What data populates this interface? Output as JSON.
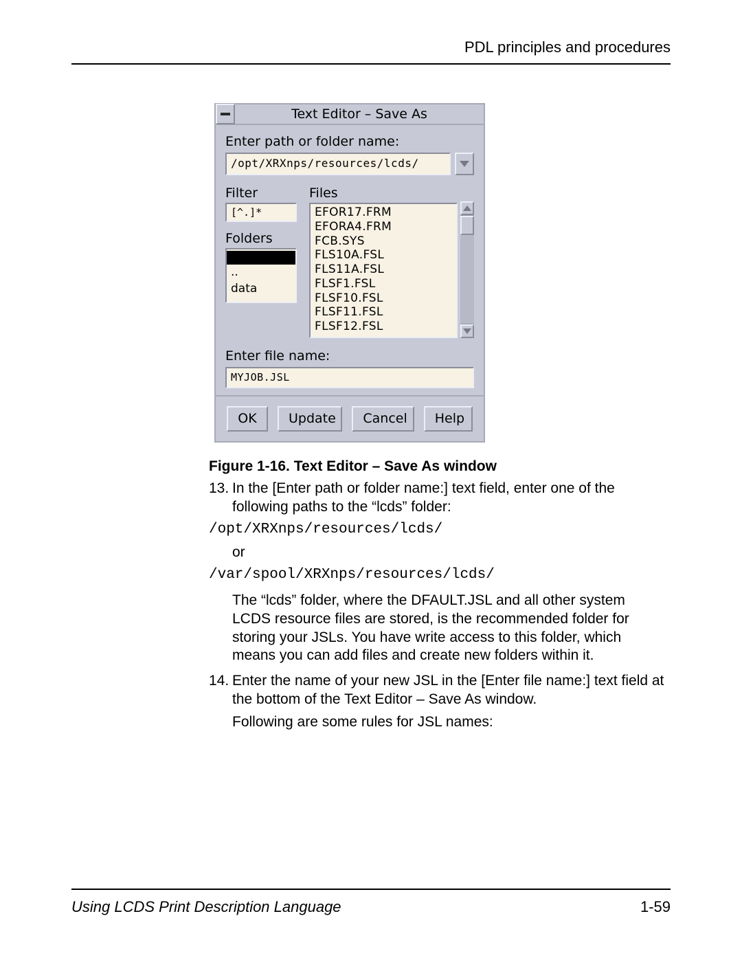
{
  "header": {
    "section_title": "PDL principles and procedures"
  },
  "dialog": {
    "title": "Text Editor – Save As",
    "path_label": "Enter path or folder name:",
    "path_value": "/opt/XRXnps/resources/lcds/",
    "filter_label": "Filter",
    "filter_value": "[^.]*",
    "folders_label": "Folders",
    "folders": {
      "item_dotdot": "..",
      "item_data": "data"
    },
    "files_label": "Files",
    "files": {
      "f0": "EFOR17.FRM",
      "f1": "EFORA4.FRM",
      "f2": "FCB.SYS",
      "f3": "FLS10A.FSL",
      "f4": "FLS11A.FSL",
      "f5": "FLSF1.FSL",
      "f6": "FLSF10.FSL",
      "f7": "FLSF11.FSL",
      "f8": "FLSF12.FSL"
    },
    "filename_label": "Enter file name:",
    "filename_value": "MYJOB.JSL",
    "buttons": {
      "ok": "OK",
      "update": "Update",
      "cancel": "Cancel",
      "help": "Help"
    }
  },
  "caption": "Figure 1-16.  Text Editor – Save As window",
  "steps": {
    "s13_num": "13.",
    "s13_text": "In the [Enter path or folder name:] text field, enter one of the following paths to the “lcds” folder:",
    "path1": "/opt/XRXnps/resources/lcds/",
    "or": "or",
    "path2": "/var/spool/XRXnps/resources/lcds/",
    "para1": "The “lcds” folder, where the DFAULT.JSL and all other system LCDS resource files are stored, is the recommended folder for storing your JSLs. You have write access to this folder, which means you can add files and create new folders within it.",
    "s14_num": "14.",
    "s14_text": "Enter the name of your new JSL in the [Enter file name:] text field at the bottom of the Text Editor – Save As window.",
    "para2": "Following are some rules for JSL names:"
  },
  "footer": {
    "book": "Using LCDS Print Description Language",
    "page": "1-59"
  }
}
